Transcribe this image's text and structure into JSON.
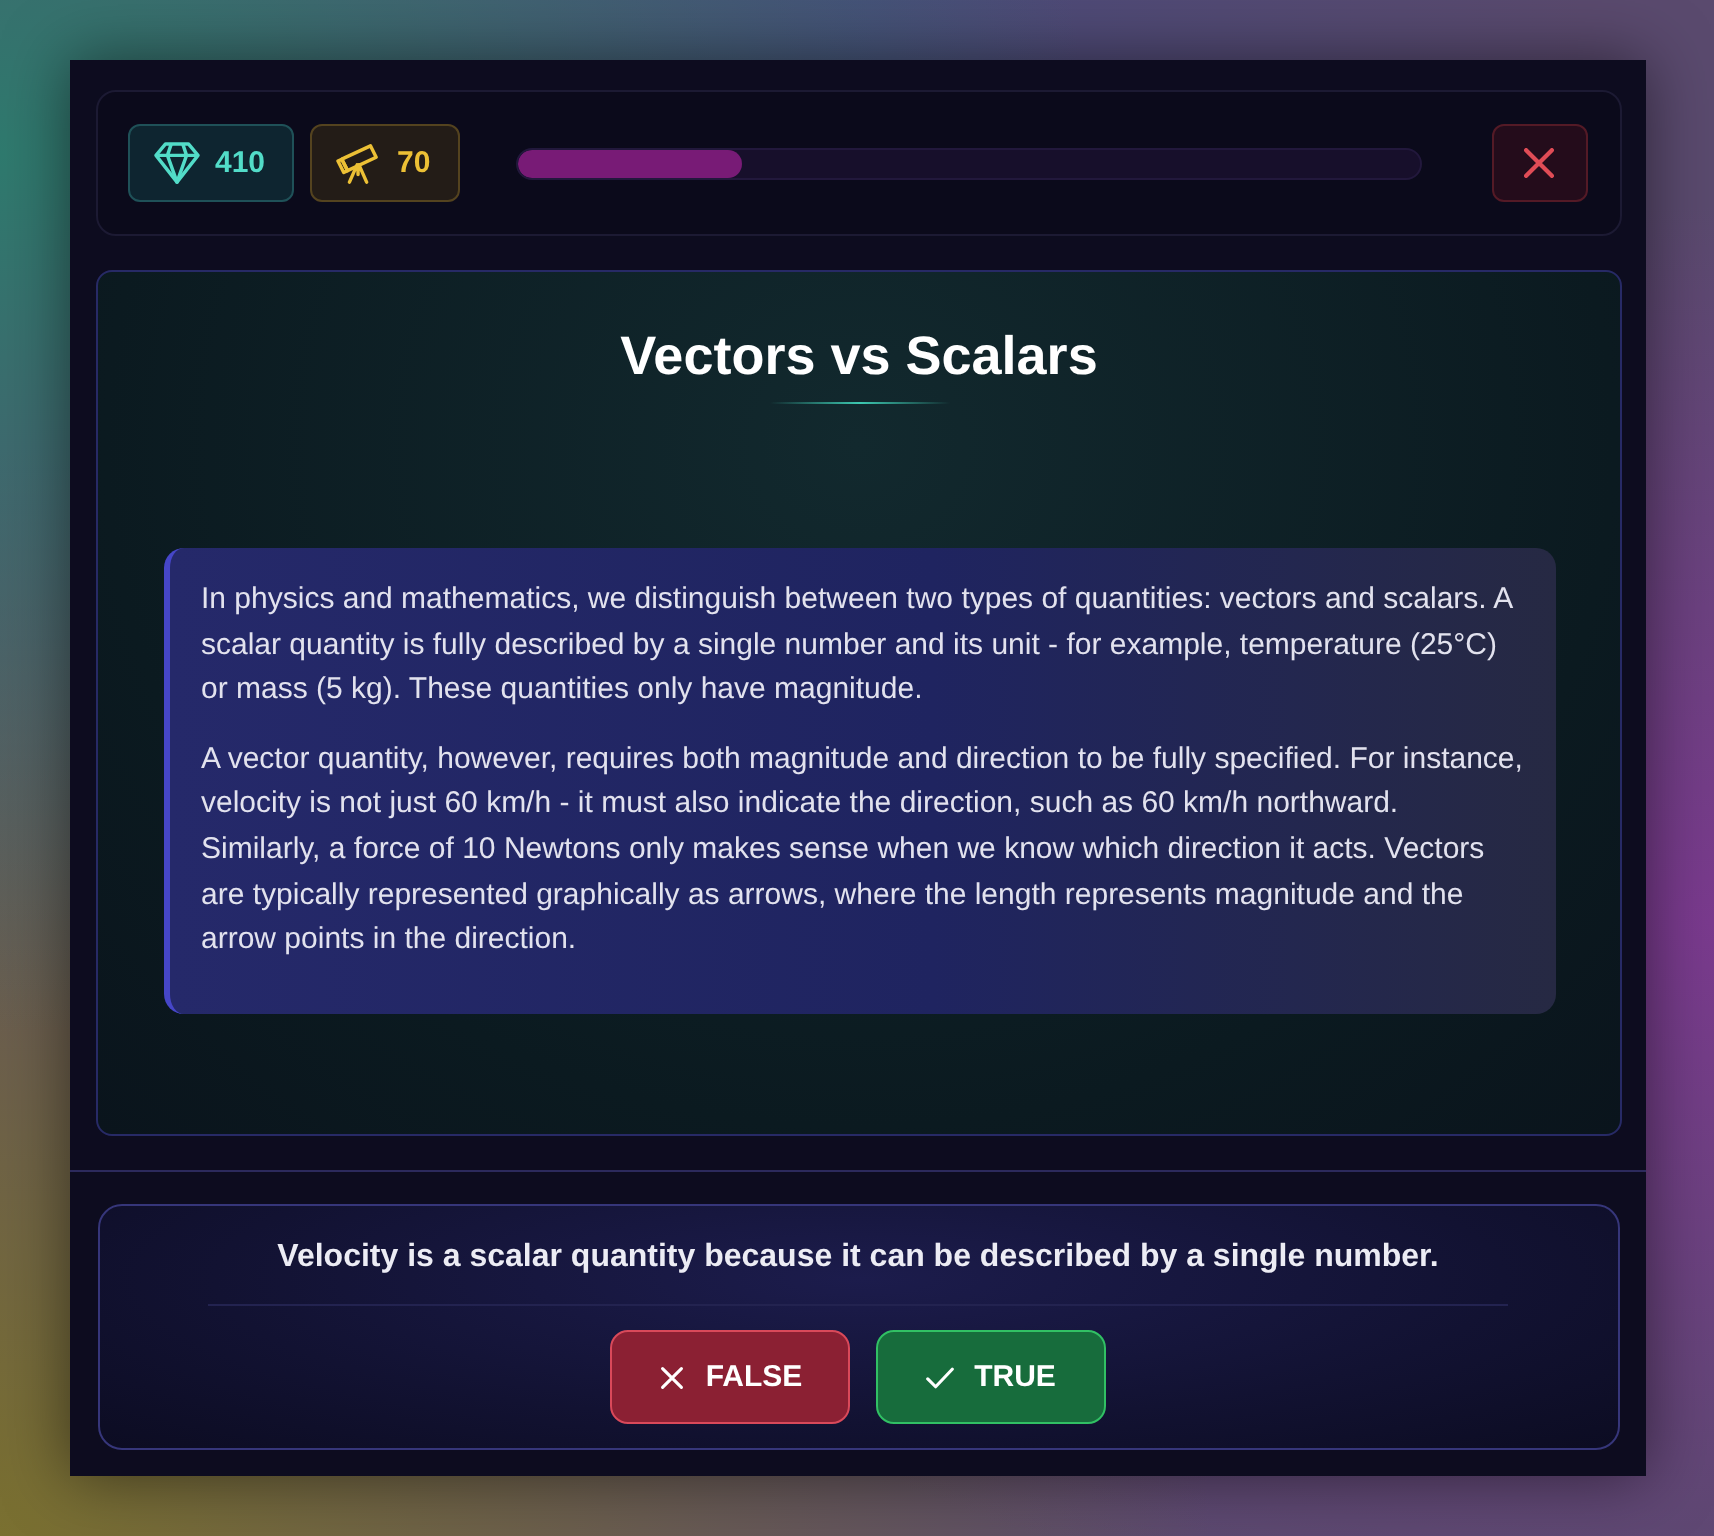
{
  "header": {
    "stats": [
      {
        "kind": "gems",
        "value": "410"
      },
      {
        "kind": "telescope",
        "value": "70"
      }
    ],
    "progress": {
      "level": 0.25
    }
  },
  "lesson": {
    "title": "Vectors vs Scalars",
    "paragraphs": [
      "In physics and mathematics, we distinguish between two types of quantities: vectors and scalars. A scalar quantity is fully described by a single number and its unit - for example, temperature (25°C) or mass (5 kg). These quantities only have magnitude.",
      "A vector quantity, however, requires both magnitude and direction to be fully specified. For instance, velocity is not just 60 km/h - it must also indicate the direction, such as 60 km/h northward. Similarly, a force of 10 Newtons only makes sense when we know which direction it acts. Vectors are typically represented graphically as arrows, where the length represents magnitude and the arrow points in the direction."
    ]
  },
  "question": {
    "statement": "Velocity is a scalar quantity because it can be described by a single number.",
    "answers": [
      {
        "kind": "false",
        "label": "FALSE"
      },
      {
        "kind": "true",
        "label": "TRUE"
      }
    ]
  }
}
